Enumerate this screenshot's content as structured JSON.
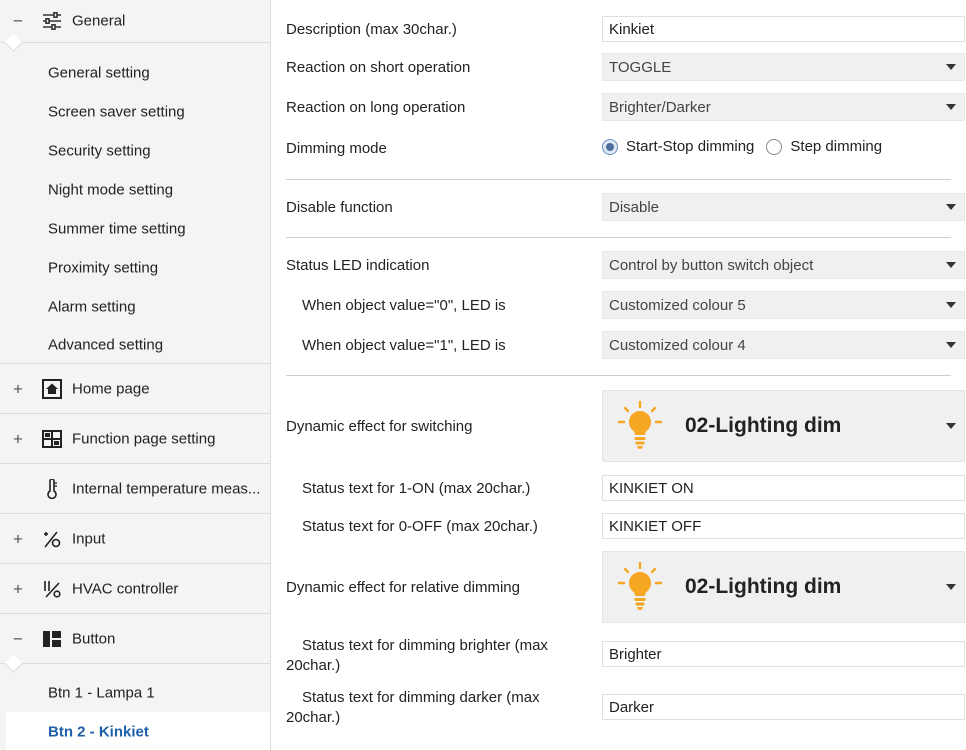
{
  "sidebar": {
    "general": {
      "label": "General",
      "toggle": "−"
    },
    "general_items": [
      "General setting",
      "Screen saver setting",
      "Security setting",
      "Night mode setting",
      "Summer time setting",
      "Proximity setting",
      "Alarm setting",
      "Advanced setting"
    ],
    "home_page": {
      "label": "Home page",
      "toggle": "+"
    },
    "function_page": {
      "label": "Function page setting",
      "toggle": "+"
    },
    "internal_temp": {
      "label": "Internal temperature meas..."
    },
    "input": {
      "label": "Input",
      "toggle": "+"
    },
    "hvac": {
      "label": "HVAC controller",
      "toggle": "+"
    },
    "button": {
      "label": "Button",
      "toggle": "−"
    },
    "button_items": [
      "Btn 1 - Lampa 1",
      "Btn 2 - Kinkiet"
    ]
  },
  "form": {
    "description": {
      "label": "Description (max 30char.)",
      "value": "Kinkiet"
    },
    "short_op": {
      "label": "Reaction on short operation",
      "value": "TOGGLE"
    },
    "long_op": {
      "label": "Reaction on long operation",
      "value": "Brighter/Darker"
    },
    "dimming_mode": {
      "label": "Dimming mode",
      "option1": "Start-Stop dimming",
      "option2": "Step dimming",
      "selected": "Start-Stop dimming"
    },
    "disable_function": {
      "label": "Disable function",
      "value": "Disable"
    },
    "status_led": {
      "label": "Status LED indication",
      "value": "Control by button switch object"
    },
    "led_0": {
      "label": "When object value=\"0\", LED is",
      "value": "Customized colour 5"
    },
    "led_1": {
      "label": "When object value=\"1\", LED is",
      "value": "Customized colour 4"
    },
    "dyn_switch": {
      "label": "Dynamic effect for switching",
      "value": "02-Lighting dim",
      "icon": "lightbulb-icon"
    },
    "status_on": {
      "label": "Status text for 1-ON (max 20char.)",
      "value": "KINKIET ON"
    },
    "status_off": {
      "label": "Status text for 0-OFF (max 20char.)",
      "value": "KINKIET OFF"
    },
    "dyn_dim": {
      "label": "Dynamic effect for relative dimming",
      "value": "02-Lighting dim",
      "icon": "lightbulb-icon"
    },
    "status_brighter": {
      "label": "Status text for dimming brighter (max 20char.)",
      "value": "Brighter"
    },
    "status_darker": {
      "label": "Status text for dimming darker (max 20char.)",
      "value": "Darker"
    }
  },
  "colors": {
    "accent": "#1e5fa8",
    "bulb": "#f5a623",
    "select_bg": "#f0f0f0"
  }
}
